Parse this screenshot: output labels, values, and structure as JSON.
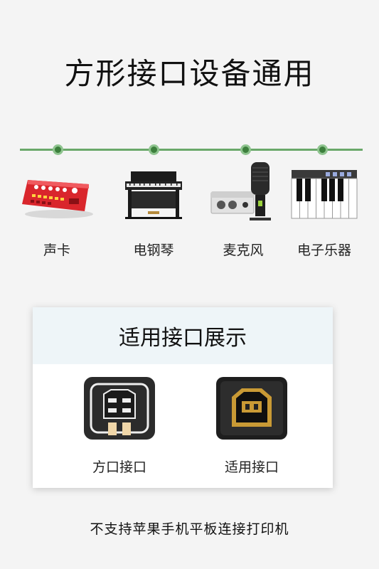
{
  "header": {
    "title": "方形接口设备通用"
  },
  "devices": [
    {
      "label": "声卡",
      "icon": "sound-card-icon"
    },
    {
      "label": "电钢琴",
      "icon": "digital-piano-icon"
    },
    {
      "label": "麦克风",
      "icon": "microphone-icon"
    },
    {
      "label": "电子乐器",
      "icon": "keyboard-instrument-icon"
    }
  ],
  "card": {
    "title": "适用接口展示",
    "ports": [
      {
        "label": "方口接口",
        "icon": "usb-b-port-diagram-icon"
      },
      {
        "label": "适用接口",
        "icon": "usb-b-port-photo-icon"
      }
    ]
  },
  "footer": {
    "note": "不支持苹果手机平板连接打印机"
  },
  "colors": {
    "timeline": "#6aa86a",
    "dot": "#3c7f3c",
    "card_header": "#eef5f8"
  }
}
